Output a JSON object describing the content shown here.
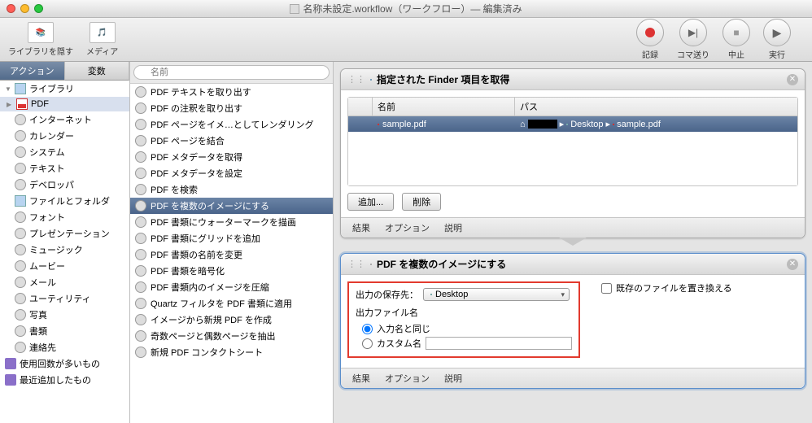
{
  "window": {
    "title": "名称未設定.workflow（ワークフロー）— 編集済み"
  },
  "toolbar": {
    "hideLibrary": "ライブラリを隠す",
    "media": "メディア",
    "record": "記録",
    "step": "コマ送り",
    "stop": "中止",
    "run": "実行"
  },
  "tabs": {
    "action": "アクション",
    "vars": "変数"
  },
  "sidebar": {
    "libraryHeader": "ライブラリ",
    "categories": [
      {
        "label": "PDF",
        "icon": "ic-pdf",
        "selected": true
      },
      {
        "label": "インターネット",
        "icon": "ic-gear"
      },
      {
        "label": "カレンダー",
        "icon": "ic-gear"
      },
      {
        "label": "システム",
        "icon": "ic-gear"
      },
      {
        "label": "テキスト",
        "icon": "ic-gear"
      },
      {
        "label": "デベロッパ",
        "icon": "ic-gear"
      },
      {
        "label": "ファイルとフォルダ",
        "icon": "ic-folder"
      },
      {
        "label": "フォント",
        "icon": "ic-gear"
      },
      {
        "label": "プレゼンテーション",
        "icon": "ic-gear"
      },
      {
        "label": "ミュージック",
        "icon": "ic-gear"
      },
      {
        "label": "ムービー",
        "icon": "ic-gear"
      },
      {
        "label": "メール",
        "icon": "ic-gear"
      },
      {
        "label": "ユーティリティ",
        "icon": "ic-gear"
      },
      {
        "label": "写真",
        "icon": "ic-gear"
      },
      {
        "label": "書類",
        "icon": "ic-gear"
      },
      {
        "label": "連絡先",
        "icon": "ic-gear"
      }
    ],
    "smart": [
      {
        "label": "使用回数が多いもの"
      },
      {
        "label": "最近追加したもの"
      }
    ]
  },
  "search": {
    "placeholder": "名前"
  },
  "actions": [
    {
      "label": "PDF テキストを取り出す"
    },
    {
      "label": "PDF の注釈を取り出す"
    },
    {
      "label": "PDF ページをイメ…としてレンダリング"
    },
    {
      "label": "PDF ページを結合"
    },
    {
      "label": "PDF メタデータを取得"
    },
    {
      "label": "PDF メタデータを設定"
    },
    {
      "label": "PDF を検索"
    },
    {
      "label": "PDF を複数のイメージにする",
      "selected": true
    },
    {
      "label": "PDF 書類にウォーターマークを描画"
    },
    {
      "label": "PDF 書類にグリッドを追加"
    },
    {
      "label": "PDF 書類の名前を変更"
    },
    {
      "label": "PDF 書類を暗号化"
    },
    {
      "label": "PDF 書類内のイメージを圧縮"
    },
    {
      "label": "Quartz フィルタを PDF 書類に適用"
    },
    {
      "label": "イメージから新規 PDF を作成"
    },
    {
      "label": "奇数ページと偶数ページを抽出"
    },
    {
      "label": "新規 PDF コンタクトシート"
    }
  ],
  "wf": {
    "finder": {
      "title": "指定された Finder 項目を取得",
      "colName": "名前",
      "colPath": "パス",
      "file": "sample.pdf",
      "path": [
        "Desktop",
        "sample.pdf"
      ],
      "add": "追加...",
      "remove": "削除"
    },
    "render": {
      "title": "PDF を複数のイメージにする",
      "saveLabel": "出力の保存先：",
      "saveDest": "Desktop",
      "fnameLabel": "出力ファイル名",
      "optSame": "入力名と同じ",
      "optCustom": "カスタム名",
      "replace": "既存のファイルを置き換える"
    },
    "footer": {
      "results": "結果",
      "options": "オプション",
      "desc": "説明"
    }
  }
}
